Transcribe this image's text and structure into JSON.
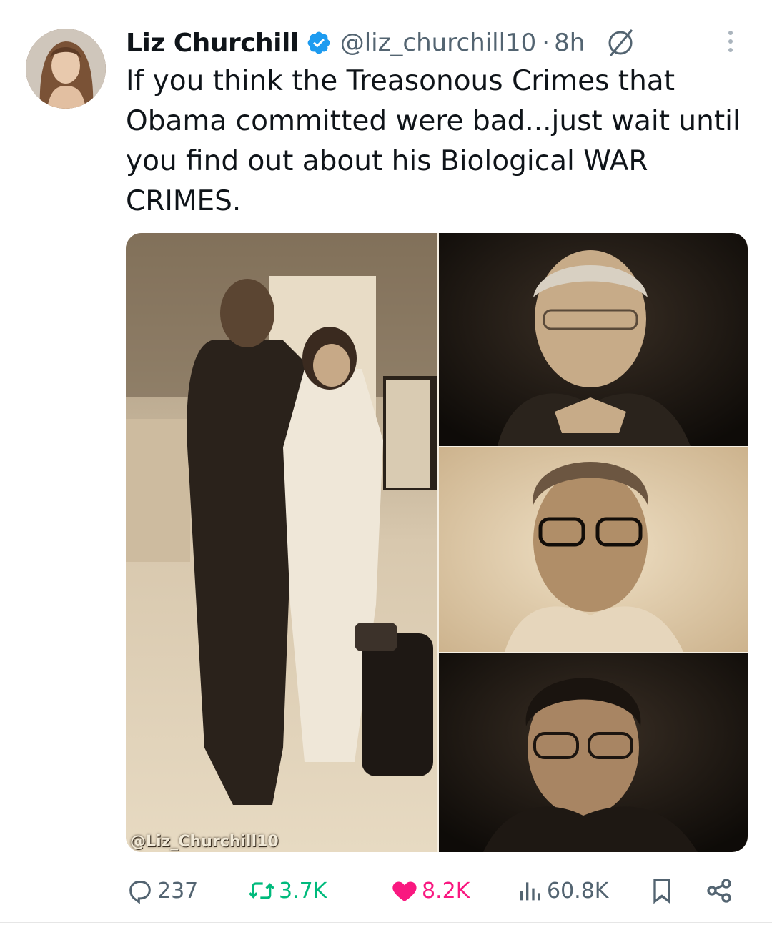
{
  "author": {
    "name": "Liz Churchill",
    "handle": "@liz_churchill10",
    "separator": "·",
    "time": "8h"
  },
  "tweet": {
    "text": "If you think the Treasonous Crimes that Obama committed were bad...just wait until you find out about his Biological WAR CRIMES."
  },
  "media": {
    "watermark": "@Liz_Churchill10"
  },
  "metrics": {
    "replies": "237",
    "reposts": "3.7K",
    "likes": "8.2K",
    "views": "60.8K"
  },
  "colors": {
    "verified": "#1d9bf0",
    "repost": "#00ba7c",
    "like": "#f91880",
    "muted": "#536471"
  },
  "icons": [
    "verified-badge-icon",
    "no-symbol-icon",
    "more-icon",
    "reply-icon",
    "repost-icon",
    "like-icon",
    "views-icon",
    "bookmark-icon",
    "share-icon"
  ]
}
